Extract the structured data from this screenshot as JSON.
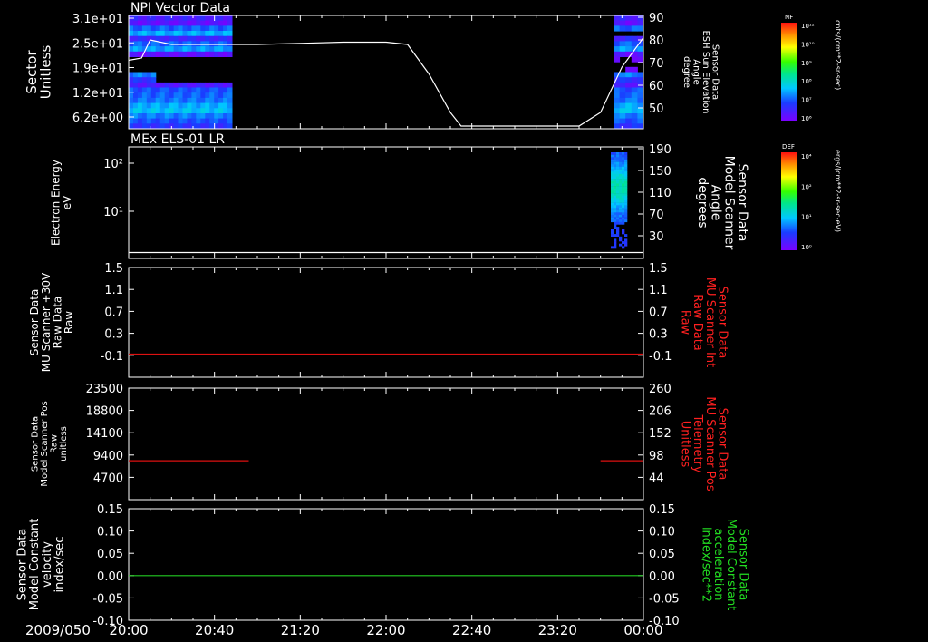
{
  "chart_data": [
    {
      "type": "heatmap",
      "title": "NPI Vector Data",
      "ylabel_left": [
        "Sector",
        "Unitless"
      ],
      "yticks_left": [
        "3.1e+01",
        "2.5e+01",
        "1.9e+01",
        "1.2e+01",
        "6.2e+00"
      ],
      "ylabel_right": [
        "Sensor Data",
        "ESH Sun Elevation",
        "Angle",
        "degree"
      ],
      "yticks_right": [
        "90",
        "80",
        "70",
        "60",
        "50"
      ],
      "right_range": [
        40,
        90
      ],
      "overlay_line": {
        "name": "ESH Sun Elevation Angle",
        "x": [
          "20:00",
          "20:06",
          "20:10",
          "20:20",
          "20:40",
          "21:00",
          "21:20",
          "21:40",
          "22:00",
          "22:10",
          "22:20",
          "22:30",
          "22:35",
          "22:40",
          "23:00",
          "23:20",
          "23:30",
          "23:40",
          "23:50",
          "24:00"
        ],
        "y": [
          71,
          72,
          80,
          78,
          78,
          78,
          78.5,
          79,
          79,
          78,
          65,
          48,
          42,
          42,
          42,
          42,
          42,
          48,
          68,
          81
        ]
      },
      "colorbar": {
        "name": "NF",
        "units": "cnts/(cm**2-sr-sec)",
        "ticks": [
          "10¹²",
          "10¹⁰",
          "10⁹",
          "10⁸",
          "10⁷",
          "10⁶"
        ]
      }
    },
    {
      "type": "heatmap",
      "title": "MEx ELS-01 LR",
      "ylabel_left": [
        "Electron Energy",
        "eV"
      ],
      "yticks_left": [
        "10²",
        "10¹"
      ],
      "ylabel_right": [
        "Sensor Data",
        "Model Scanner",
        "Angle",
        "degrees"
      ],
      "yticks_right": [
        "190",
        "150",
        "110",
        "70",
        "30"
      ],
      "right_range": [
        0,
        190
      ],
      "overlay_line": {
        "name": "Model Scanner Angle",
        "x": [
          "20:00",
          "24:00"
        ],
        "y": [
          10,
          10
        ]
      },
      "colorbar": {
        "name": "DEF",
        "units": "ergs/(cm**2-sr-sec-eV)",
        "ticks": [
          "10⁴",
          "10²",
          "10¹",
          "10⁰"
        ]
      }
    },
    {
      "type": "line",
      "ylabel_left": [
        "Sensor Data",
        "MU Scanner +30V",
        "Raw Data",
        "Raw"
      ],
      "yticks_left": [
        "1.5",
        "1.1",
        "0.7",
        "0.3",
        "-0.1"
      ],
      "ylabel_right": [
        "Sensor Data",
        "MU Scanner Int",
        "Raw Data",
        "Raw"
      ],
      "yticks_right": [
        "1.5",
        "1.1",
        "0.7",
        "0.3",
        "-0.1"
      ],
      "ylim": [
        -0.4,
        1.5
      ],
      "series": [
        {
          "color": "#dd1111",
          "x": [
            "20:00",
            "24:00"
          ],
          "y": [
            0.0,
            0.0
          ]
        }
      ]
    },
    {
      "type": "line",
      "ylabel_left": [
        "Sensor Data",
        "Model Scanner Pos",
        "Raw",
        "unitless"
      ],
      "yticks_left": [
        "23500",
        "18800",
        "14100",
        "9400",
        "4700"
      ],
      "ylabel_right": [
        "Sensor Data",
        "MU Scanner Pos",
        "Telemetry",
        "Unitless"
      ],
      "yticks_right": [
        "260",
        "206",
        "152",
        "98",
        "44"
      ],
      "ylim": [
        0,
        23500
      ],
      "series": [
        {
          "color": "#dd1111",
          "x": [
            "20:00",
            "20:56"
          ],
          "y": [
            8200,
            8200
          ]
        },
        {
          "color": "#dd1111",
          "x": [
            "23:40",
            "24:00"
          ],
          "y": [
            8200,
            8200
          ]
        }
      ]
    },
    {
      "type": "line",
      "ylabel_left": [
        "Sensor Data",
        "Model Constant",
        "velocity",
        "index/sec"
      ],
      "yticks_left": [
        "0.15",
        "0.10",
        "0.05",
        "0.00",
        "-0.05",
        "-0.10"
      ],
      "ylabel_right": [
        "Sensor Data",
        "Model Constant",
        "acceleration",
        "index/sec**2"
      ],
      "yticks_right": [
        "0.15",
        "0.10",
        "0.05",
        "0.00",
        "-0.05",
        "-0.10"
      ],
      "ylim": [
        -0.1,
        0.15
      ],
      "series": [
        {
          "color": "#22cc22",
          "x": [
            "20:00",
            "24:00"
          ],
          "y": [
            0.0,
            0.0
          ]
        }
      ]
    }
  ],
  "x_axis": {
    "date_label": "2009/050",
    "ticks": [
      "20:00",
      "20:40",
      "21:20",
      "22:00",
      "22:40",
      "23:20",
      "00:00"
    ]
  },
  "colors": {
    "background": "#000000",
    "foreground": "#ffffff",
    "panel3_right_label": "#ff2020",
    "panel4_right_label": "#ff2020",
    "panel5_right_label": "#22dd22"
  }
}
